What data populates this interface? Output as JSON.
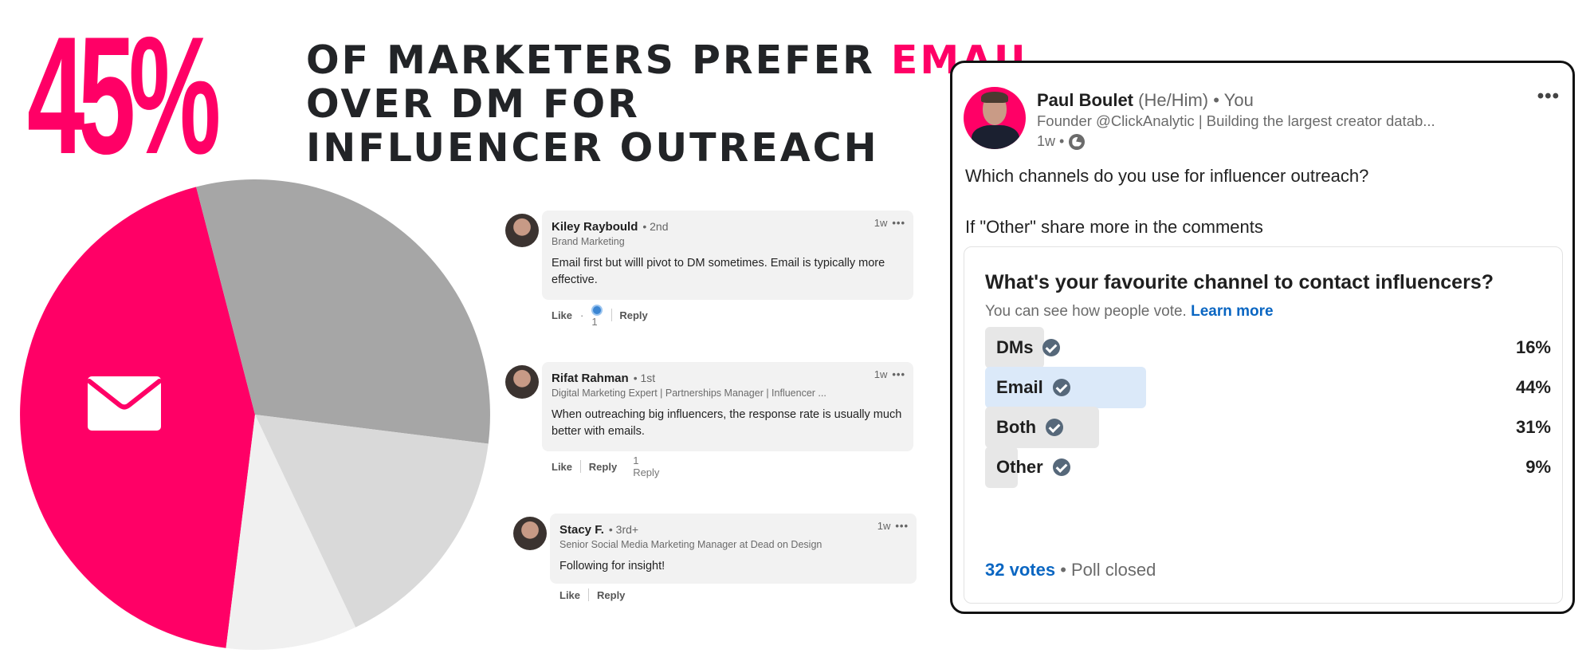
{
  "headline": {
    "stat": "45%",
    "line_prefix": "OF MARKETERS PREFER ",
    "accent_word": "EMAIL",
    "line_rest": "OVER DM FOR INFLUENCER OUTREACH",
    "accent_color": "#ff0066"
  },
  "chart_data": {
    "type": "pie",
    "title": "",
    "categories": [
      "Email",
      "Both",
      "DMs",
      "Other"
    ],
    "values": [
      44,
      31,
      16,
      9
    ],
    "colors": [
      "#ff0066",
      "#a6a6a6",
      "#d9d9d9",
      "#f0f0f0"
    ],
    "highlight": "Email",
    "highlight_icon": "envelope-icon",
    "legend": "none"
  },
  "comments": [
    {
      "name": "Kiley Raybould",
      "degree": "• 2nd",
      "title": "Brand Marketing",
      "text": "Email first but willl pivot to DM sometimes. Email is typically more effective.",
      "time": "1w",
      "more": "•••",
      "like_label": "Like",
      "like_sep": "·",
      "reactions": "1",
      "reply_label": "Reply",
      "replies": ""
    },
    {
      "name": "Rifat Rahman",
      "degree": "• 1st",
      "title": "Digital Marketing Expert | Partnerships Manager | Influencer ...",
      "text": "When outreaching big influencers, the response rate is usually much better with emails.",
      "time": "1w",
      "more": "•••",
      "like_label": "Like",
      "reply_label": "Reply",
      "replies": "1 Reply"
    },
    {
      "name": "Stacy F.",
      "degree": "• 3rd+",
      "title": "Senior Social Media Marketing Manager at Dead on Design",
      "text": "Following for insight!",
      "time": "1w",
      "more": "•••",
      "like_label": "Like",
      "reply_label": "Reply",
      "replies": ""
    }
  ],
  "post": {
    "author": "Paul Boulet",
    "pronouns": "(He/Him)",
    "you": "• You",
    "tagline": "Founder @ClickAnalytic | Building the largest creator datab...",
    "time": "1w •",
    "more": "•••",
    "body_line1": "Which channels do you use for influencer outreach?",
    "body_line2": "If \"Other\" share more in the comments",
    "poll": {
      "question": "What's your favourite channel to contact influencers?",
      "subtitle": "You can see how people vote.",
      "learn_more": "Learn more",
      "options": [
        {
          "label": "DMs",
          "percent_label": "16%",
          "percent": 16,
          "selected": false
        },
        {
          "label": "Email",
          "percent_label": "44%",
          "percent": 44,
          "selected": true
        },
        {
          "label": "Both",
          "percent_label": "31%",
          "percent": 31,
          "selected": false
        },
        {
          "label": "Other",
          "percent_label": "9%",
          "percent": 9,
          "selected": false
        }
      ],
      "votes": "32 votes",
      "status": "• Poll closed"
    }
  }
}
